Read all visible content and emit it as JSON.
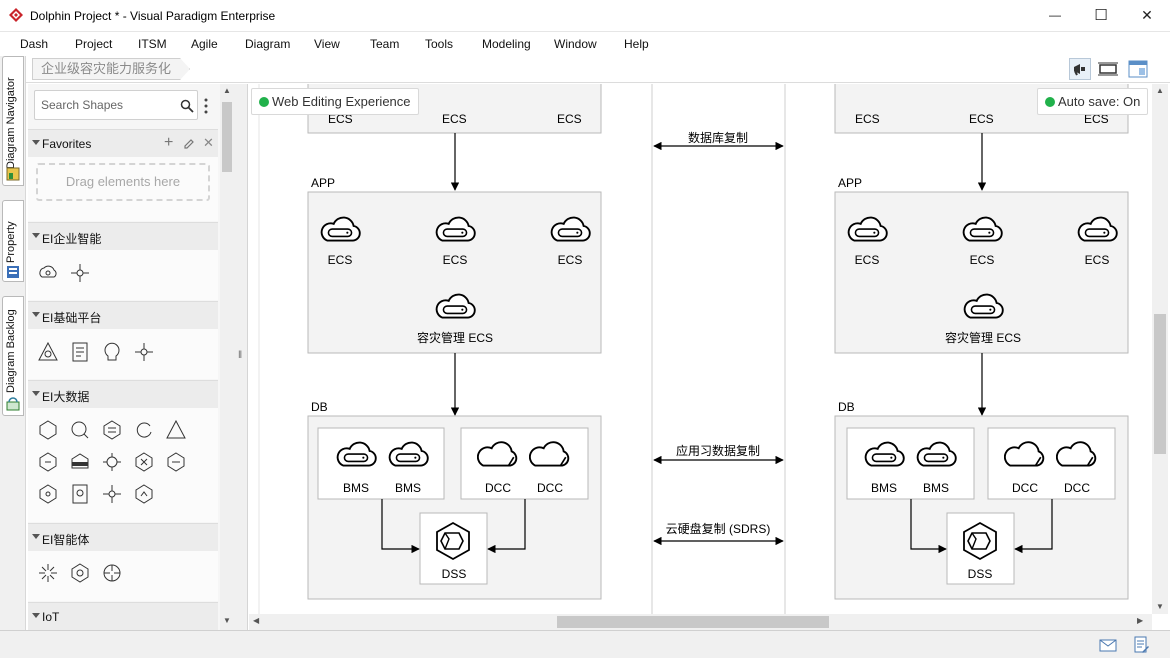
{
  "window": {
    "title": "Dolphin Project * - Visual Paradigm Enterprise",
    "minimize_glyph": "—",
    "maximize_glyph": "☐",
    "close_glyph": "✕"
  },
  "menu": [
    "Dash",
    "Project",
    "ITSM",
    "Agile",
    "Diagram",
    "View",
    "Team",
    "Tools",
    "Modeling",
    "Window",
    "Help"
  ],
  "breadcrumb": "企业级容灾能力服务化",
  "left_tabs": {
    "diagram_navigator": "Diagram Navigator",
    "property": "Property",
    "diagram_backlog": "Diagram Backlog"
  },
  "palette": {
    "search_placeholder": "Search Shapes",
    "favorites": {
      "label": "Favorites",
      "dropzone": "Drag elements here"
    },
    "groups": [
      {
        "label": "EI企业智能",
        "icon_count": 2
      },
      {
        "label": "EI基础平台",
        "icon_count": 4
      },
      {
        "label": "EI大数据",
        "icon_count": 15
      },
      {
        "label": "EI智能体",
        "icon_count": 3
      },
      {
        "label": "IoT",
        "icon_count": 0
      }
    ]
  },
  "canvas": {
    "web_editing_chip": "Web Editing Experience",
    "auto_save_chip": "Auto save: On",
    "status_color": "#21b14b",
    "diagram": {
      "left_site": {
        "top_partial_labels": [
          "ECS",
          "ECS",
          "ECS"
        ],
        "app_label": "APP",
        "app_nodes": [
          "ECS",
          "ECS",
          "ECS"
        ],
        "dr_node": "容灾管理 ECS",
        "db_label": "DB",
        "bms_nodes": [
          "BMS",
          "BMS"
        ],
        "dcc_nodes": [
          "DCC",
          "DCC"
        ],
        "dss_node": "DSS"
      },
      "right_site": {
        "top_partial_labels": [
          "ECS",
          "ECS",
          "ECS"
        ],
        "app_label": "APP",
        "app_nodes": [
          "ECS",
          "ECS",
          "ECS"
        ],
        "dr_node": "容灾管理 ECS",
        "db_label": "DB",
        "bms_nodes": [
          "BMS",
          "BMS"
        ],
        "dcc_nodes": [
          "DCC",
          "DCC"
        ],
        "dss_node": "DSS"
      },
      "replication_links": [
        "数据库复制",
        "应用习数据复制",
        "云硬盘复制 (SDRS)"
      ]
    }
  }
}
